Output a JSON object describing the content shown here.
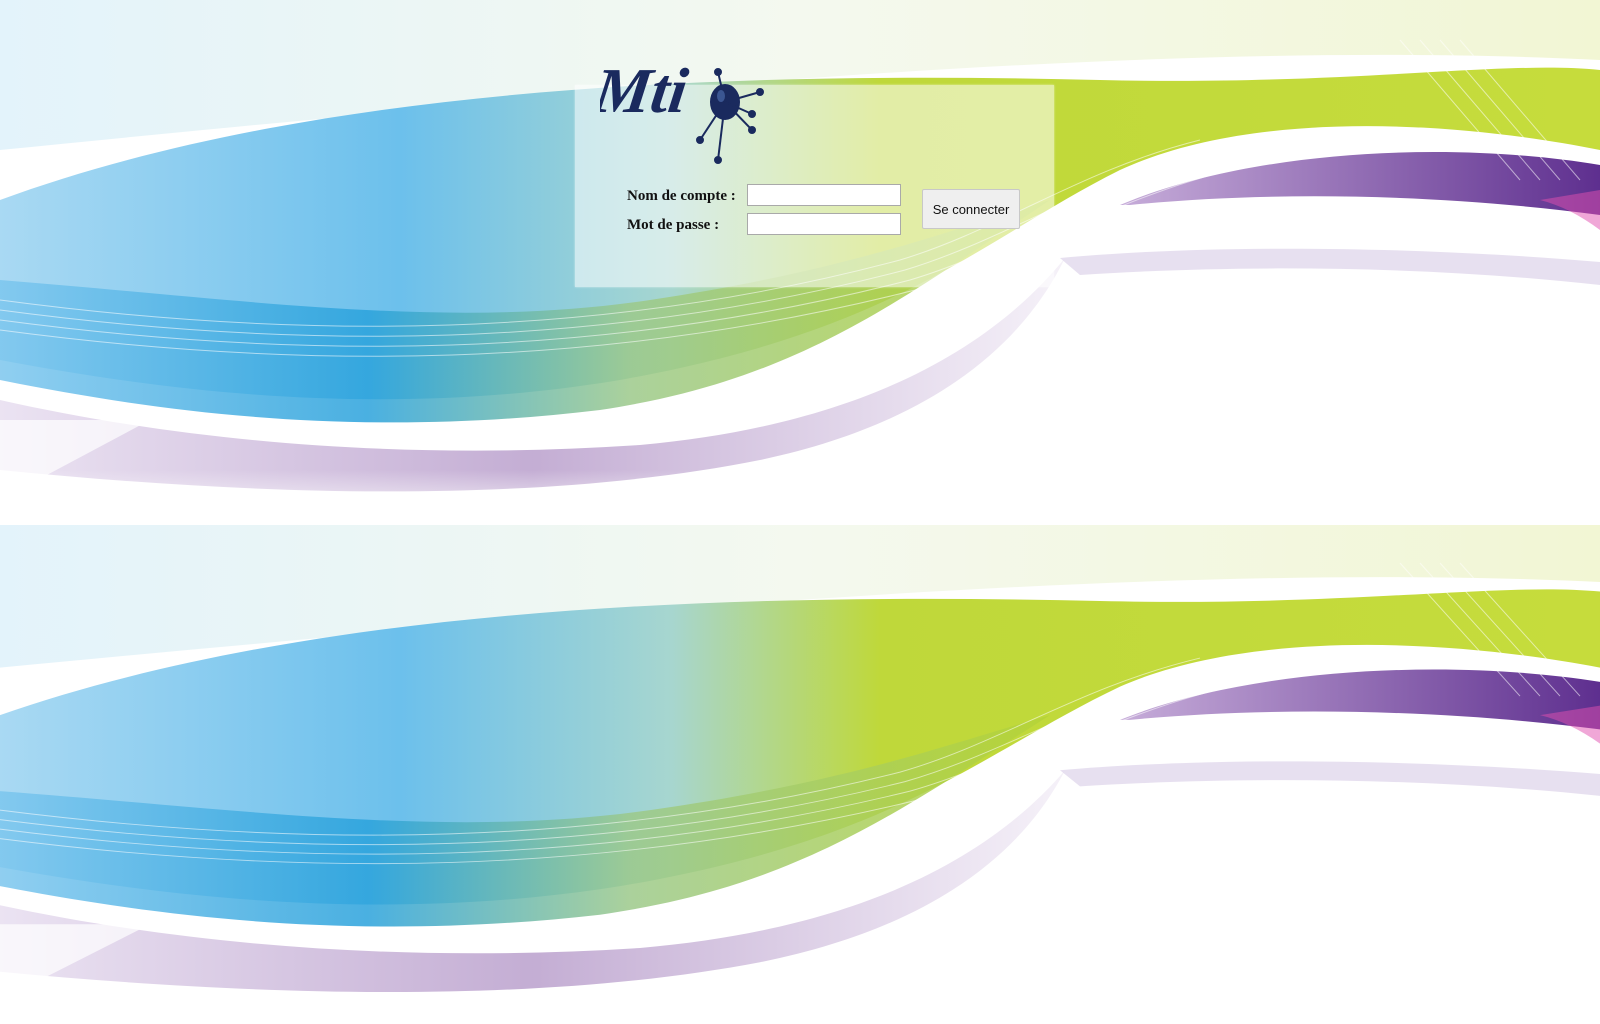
{
  "app": {
    "logo_name": "mti-logo"
  },
  "login_form": {
    "account_label": "Nom de compte :",
    "account_value": "",
    "password_label": "Mot de passe :",
    "password_value": "",
    "submit_label": "Se connecter"
  },
  "colors": {
    "logo_navy": "#1a2a5e",
    "wave_blue": "#5db8e8",
    "wave_green": "#b8d432",
    "wave_purple": "#7b4ea0"
  }
}
